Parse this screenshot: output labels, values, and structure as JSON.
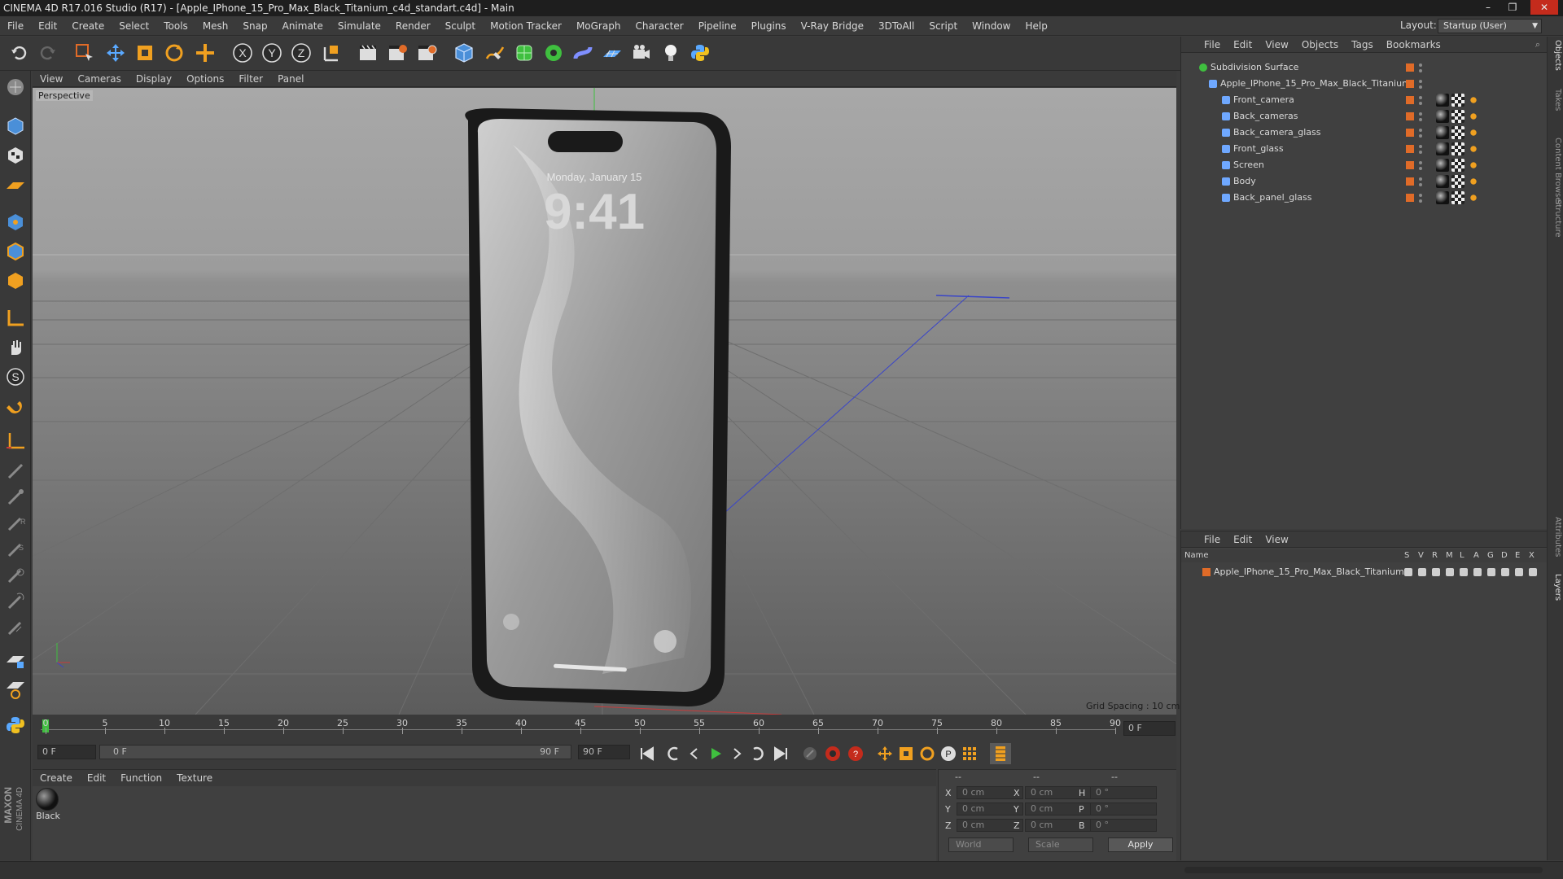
{
  "window": {
    "title": "CINEMA 4D R17.016 Studio (R17) - [Apple_IPhone_15_Pro_Max_Black_Titanium_c4d_standart.c4d] - Main",
    "min": "–",
    "max": "❐",
    "close": "✕"
  },
  "menu": [
    "File",
    "Edit",
    "Create",
    "Select",
    "Tools",
    "Mesh",
    "Snap",
    "Animate",
    "Simulate",
    "Render",
    "Sculpt",
    "Motion Tracker",
    "MoGraph",
    "Character",
    "Pipeline",
    "Plugins",
    "V-Ray Bridge",
    "3DToAll",
    "Script",
    "Window",
    "Help"
  ],
  "layout": {
    "label": "Layout:",
    "value": "Startup (User)"
  },
  "viewport": {
    "menu": [
      "View",
      "Cameras",
      "Display",
      "Options",
      "Filter",
      "Panel"
    ],
    "label": "Perspective",
    "grid": "Grid Spacing : 10 cm",
    "clock": "9:41",
    "date": "Monday, January 15"
  },
  "timeline": {
    "ticks": [
      "0",
      "5",
      "10",
      "15",
      "20",
      "25",
      "30",
      "35",
      "40",
      "45",
      "50",
      "55",
      "60",
      "65",
      "70",
      "75",
      "80",
      "85",
      "90"
    ],
    "frame_right": "0 F",
    "start": "0 F",
    "range_start": "0 F",
    "range_end": "90 F",
    "end": "90 F"
  },
  "material": {
    "menu": [
      "Create",
      "Edit",
      "Function",
      "Texture"
    ],
    "name": "Black"
  },
  "coords": {
    "head": [
      "--",
      "--",
      "--"
    ],
    "labels": [
      "X",
      "Y",
      "Z",
      "X",
      "Y",
      "Z",
      "H",
      "P",
      "B"
    ],
    "values": [
      "0 cm",
      "0 cm",
      "0 cm",
      "0 cm",
      "0 cm",
      "0 cm",
      "0 °",
      "0 °",
      "0 °"
    ],
    "mode1": "World",
    "mode2": "Scale",
    "apply": "Apply"
  },
  "objects": {
    "menu": [
      "File",
      "Edit",
      "View",
      "Objects",
      "Tags",
      "Bookmarks"
    ],
    "root": "Subdivision Surface",
    "group": "Apple_IPhone_15_Pro_Max_Black_Titanium",
    "children": [
      "Front_camera",
      "Back_cameras",
      "Back_camera_glass",
      "Front_glass",
      "Screen",
      "Body",
      "Back_panel_glass"
    ]
  },
  "layers": {
    "menu": [
      "File",
      "Edit",
      "View"
    ],
    "header": {
      "name": "Name",
      "cols": [
        "S",
        "V",
        "R",
        "M",
        "L",
        "A",
        "G",
        "D",
        "E",
        "X"
      ]
    },
    "items": [
      "Apple_IPhone_15_Pro_Max_Black_Titanium"
    ]
  },
  "sidetabs": [
    "Objects",
    "Takes",
    "Content Browser",
    "Structure",
    "Attributes",
    "Layers"
  ],
  "brand": {
    "maxon": "MAXON",
    "c4d": "CINEMA 4D"
  },
  "colors": {
    "accent": "#e06b28",
    "axis_y": "#3fbf3f",
    "axis_x": "#c83a3a",
    "axis_z": "#3a45c8"
  }
}
